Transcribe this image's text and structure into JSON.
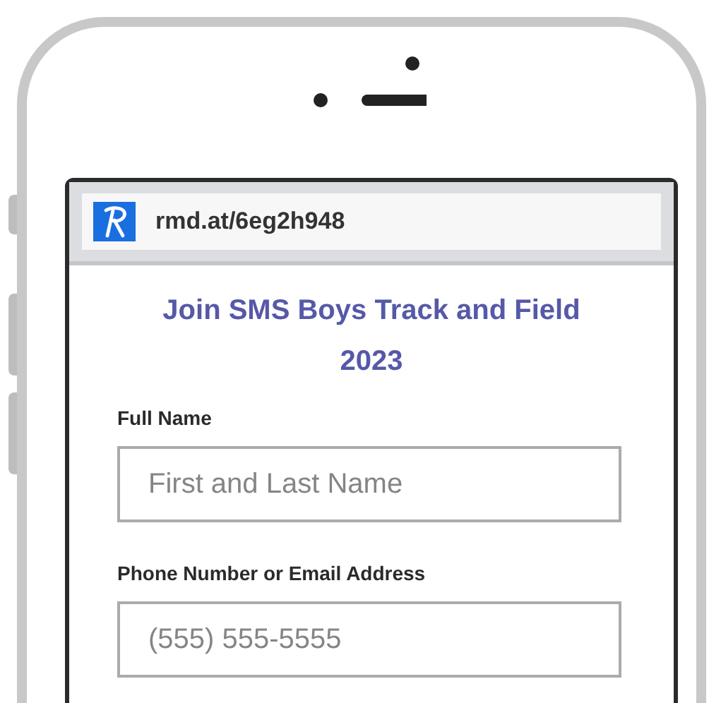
{
  "browser": {
    "url": "rmd.at/6eg2h948"
  },
  "form": {
    "title": "Join SMS Boys Track and Field 2023",
    "fields": [
      {
        "label": "Full Name",
        "placeholder": "First and Last Name"
      },
      {
        "label": "Phone Number or Email Address",
        "placeholder": "(555) 555-5555"
      }
    ]
  }
}
